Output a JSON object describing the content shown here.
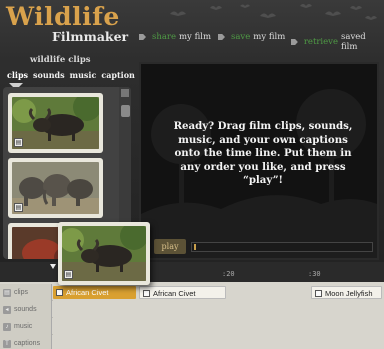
{
  "header": {
    "title": "Wildlife",
    "subtitle": "Filmmaker",
    "nav": [
      {
        "verb": "share",
        "noun": "my film"
      },
      {
        "verb": "save",
        "noun": "my film"
      },
      {
        "verb": "retrieve",
        "noun": "saved film"
      }
    ]
  },
  "clips_panel": {
    "title": "wildlife clips",
    "tabs": [
      "clips",
      "sounds",
      "music",
      "caption"
    ],
    "active_tab": "clips",
    "clips": [
      {
        "subject": "water buffalo"
      },
      {
        "subject": "elephants"
      },
      {
        "subject": "red animal"
      }
    ]
  },
  "player": {
    "message": "Ready? Drag film clips, sounds, music, and your own captions onto the time line. Put them in any order you like, and press “play”!",
    "play_label": "play"
  },
  "timeline": {
    "ticks": [
      ":20",
      ":30"
    ],
    "tracks": [
      {
        "label": "clips",
        "icon": "film-icon"
      },
      {
        "label": "sounds",
        "icon": "speaker-icon"
      },
      {
        "label": "music",
        "icon": "music-icon"
      },
      {
        "label": "captions",
        "icon": "text-icon"
      }
    ],
    "clip_items": [
      "African Civet",
      "African Civet",
      "Moon Jellyfish"
    ]
  },
  "colors": {
    "accent": "#d9a24c",
    "nav_verb": "#4f9b45",
    "selected_clip": "#d9a031"
  }
}
